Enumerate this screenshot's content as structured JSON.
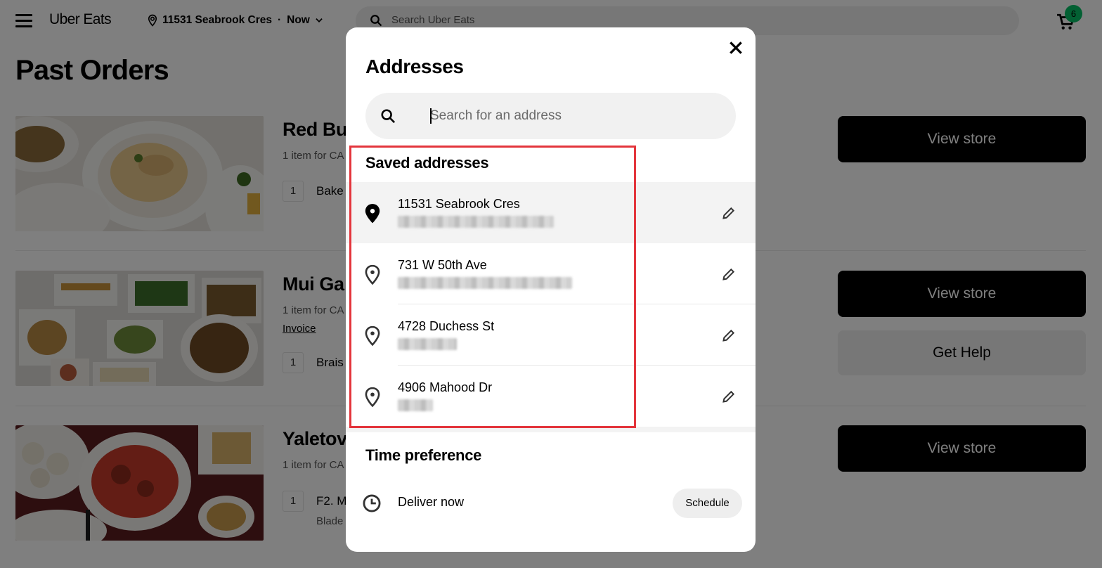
{
  "header": {
    "logo": "Uber Eats",
    "location": "11531 Seabrook Cres",
    "separator": "·",
    "time": "Now",
    "search_placeholder": "Search Uber Eats",
    "cart_count": "6"
  },
  "page": {
    "title": "Past Orders",
    "orders": [
      {
        "name": "Red Bu",
        "meta": "1 item for CA",
        "items": [
          {
            "qty": "1",
            "name": "Bake",
            "sub": ""
          }
        ],
        "buttons": [
          "View store"
        ]
      },
      {
        "name": "Mui Ga",
        "meta": "1 item for CA",
        "invoice": "Invoice",
        "items": [
          {
            "qty": "1",
            "name": "Brais",
            "sub": ""
          }
        ],
        "buttons": [
          "View store",
          "Get Help"
        ]
      },
      {
        "name": "Yaletov",
        "meta": "1 item for CA",
        "items": [
          {
            "qty": "1",
            "name": "F2. M",
            "sub": "Blade"
          }
        ],
        "buttons": [
          "View store"
        ]
      }
    ]
  },
  "modal": {
    "title": "Addresses",
    "search_placeholder": "Search for an address",
    "saved_title": "Saved addresses",
    "addresses": [
      {
        "main": "11531 Seabrook Cres",
        "selected": true
      },
      {
        "main": "731 W 50th Ave",
        "selected": false
      },
      {
        "main": "4728 Duchess St",
        "selected": false
      },
      {
        "main": "4906 Mahood Dr",
        "selected": false
      }
    ],
    "time_title": "Time preference",
    "deliver_label": "Deliver now",
    "schedule_label": "Schedule"
  },
  "colors": {
    "overlay": "rgba(0,0,0,0.5)",
    "highlight": "#e3353c",
    "badge": "#06c167",
    "button_dark": "#000000"
  }
}
